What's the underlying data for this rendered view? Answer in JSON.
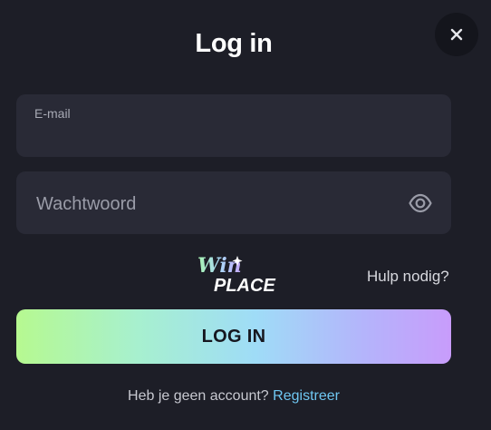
{
  "modal": {
    "title": "Log in",
    "close_icon": "close-icon"
  },
  "email": {
    "label": "E-mail",
    "value": ""
  },
  "password": {
    "placeholder": "Wachtwoord",
    "toggle_icon": "eye-icon"
  },
  "logo": {
    "line1": "Win",
    "line2": "PLACE"
  },
  "help": {
    "label": "Hulp nodig?"
  },
  "login_button": {
    "label": "LOG IN"
  },
  "signup": {
    "prompt": "Heb je geen account?",
    "link": "Registreer"
  },
  "colors": {
    "background": "#1d1e27",
    "field": "#292a36",
    "link": "#6fc7f2",
    "gradient_start": "#b6f990",
    "gradient_end": "#c89cfb"
  }
}
